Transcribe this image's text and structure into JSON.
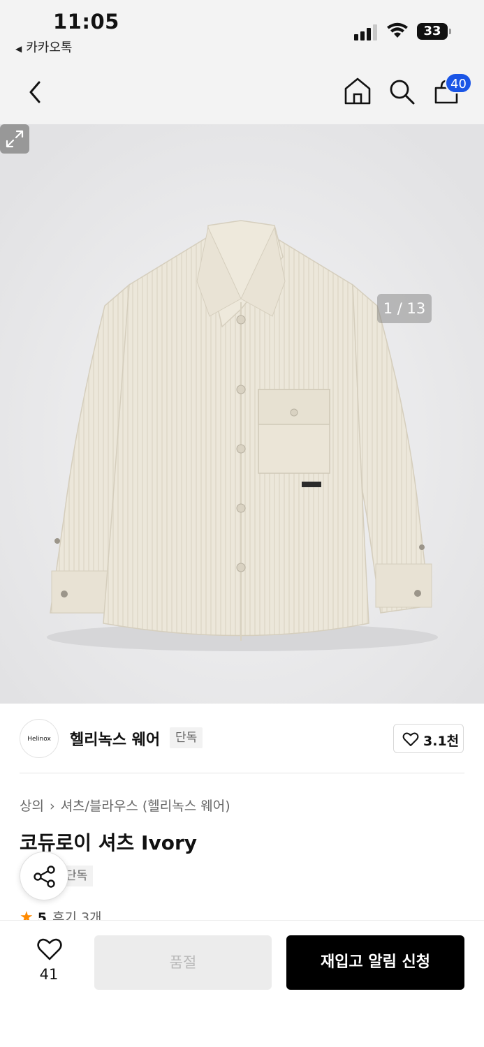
{
  "status_bar": {
    "time": "11:05",
    "back_app_label": "카카오톡",
    "battery_level": "33",
    "icons": [
      "signal-icon",
      "wifi-icon",
      "battery-icon"
    ]
  },
  "nav": {
    "icons": [
      "back-chevron-icon",
      "home-icon",
      "search-icon",
      "shopping-bag-icon"
    ],
    "cart_count": "40"
  },
  "gallery": {
    "counter": "1 / 13",
    "expand_icon": "expand-icon",
    "background": "#e9e9eb"
  },
  "brand": {
    "logo_text": "Helinox",
    "name": "헬리녹스 웨어",
    "exclusive_tag": "단독",
    "like_count": "3.1천"
  },
  "product": {
    "breadcrumb": [
      "상의",
      "셔츠/블라우스 (헬리녹스 웨어)"
    ],
    "title": "코듀로이 셔츠 Ivory",
    "exclusive_tag": "단독",
    "rating": "5",
    "review_label": "후기 3개"
  },
  "bottom_bar": {
    "like_count": "41",
    "soldout_label": "품절",
    "restock_label": "재입고 알림 신청"
  },
  "colors": {
    "accent": "#1a55e6",
    "star": "#ff8a00",
    "cta": "#000000"
  }
}
